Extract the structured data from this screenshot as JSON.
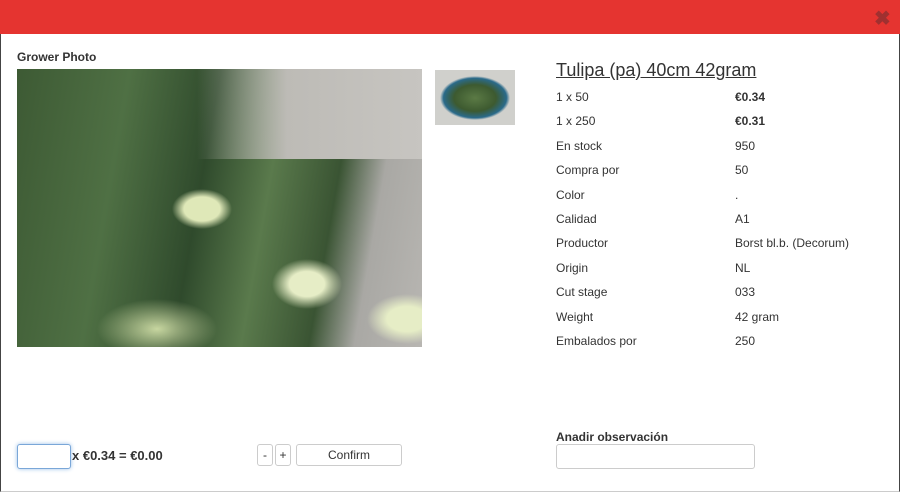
{
  "header": {
    "close_icon": "close-x-icon",
    "color": "#e53430"
  },
  "photo": {
    "title": "Grower Photo"
  },
  "product": {
    "title": "Tulipa (pa) 40cm 42gram",
    "details": [
      {
        "label": "1 x 50",
        "value": "€0.34",
        "bold": true
      },
      {
        "label": "1 x 250",
        "value": "€0.31",
        "bold": true
      },
      {
        "label": "En stock",
        "value": "950"
      },
      {
        "label": "Compra por",
        "value": "50"
      },
      {
        "label": "Color",
        "value": "."
      },
      {
        "label": "Calidad",
        "value": "A1"
      },
      {
        "label": "Productor",
        "value": "Borst bl.b. (Decorum)"
      },
      {
        "label": "Origin",
        "value": "NL"
      },
      {
        "label": "Cut stage",
        "value": "033"
      },
      {
        "label": "Weight",
        "value": "42 gram"
      },
      {
        "label": "Embalados por",
        "value": "250"
      }
    ]
  },
  "order": {
    "quantity": "",
    "calc": "x €0.34 = €0.00",
    "minus": "-",
    "plus": "+",
    "confirm": "Confirm"
  },
  "observation": {
    "label": "Anadir observación",
    "value": ""
  }
}
